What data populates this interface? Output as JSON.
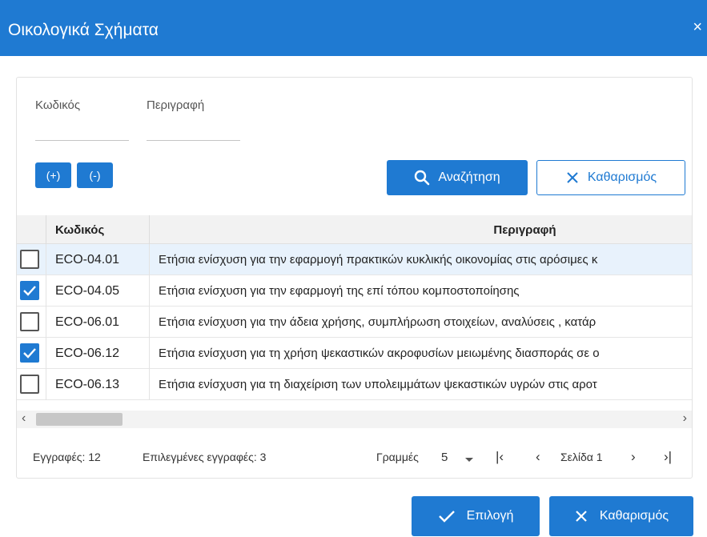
{
  "dialog": {
    "title": "Οικολογικά Σχήματα",
    "close_glyph": "×"
  },
  "filters": {
    "code_label": "Κωδικός",
    "description_label": "Περιγραφή"
  },
  "toolbar": {
    "expand_label": "(+)",
    "collapse_label": "(-)",
    "search_label": "Αναζήτηση",
    "clear_label": "Καθαρισμός"
  },
  "table": {
    "columns": [
      "Κωδικός",
      "Περιγραφή"
    ],
    "rows": [
      {
        "code": "ECO-04.01",
        "description": "Ετήσια ενίσχυση για την εφαρμογή πρακτικών κυκλικής οικονομίας στις αρόσιμες κ",
        "checked": false,
        "highlighted": true
      },
      {
        "code": "ECO-04.05",
        "description": "Ετήσια ενίσχυση για την εφαρμογή της επί τόπου κομποστοποίησης",
        "checked": true,
        "highlighted": false
      },
      {
        "code": "ECO-06.01",
        "description": "Ετήσια ενίσχυση για την άδεια χρήσης, συμπλήρωση στοιχείων, αναλύσεις , κατάρ",
        "checked": false,
        "highlighted": false
      },
      {
        "code": "ECO-06.12",
        "description": "Ετήσια ενίσχυση για τη χρήση ψεκαστικών ακροφυσίων μειωμένης διασποράς σε ο",
        "checked": true,
        "highlighted": false
      },
      {
        "code": "ECO-06.13",
        "description": "Ετήσια ενίσχυση για τη διαχείριση των υπολειμμάτων ψεκαστικών υγρών στις αροτ",
        "checked": false,
        "highlighted": false
      }
    ]
  },
  "footer": {
    "records": "Εγγραφές: 12",
    "selected": "Επιλεγμένες εγγραφές: 3",
    "rows_label": "Γραμμές",
    "rows_value": "5",
    "page_label": "Σελίδα 1"
  },
  "actions": {
    "select_label": "Επιλογή",
    "clear_label": "Καθαρισμός"
  },
  "colors": {
    "accent": "#1f7ad2",
    "row_highlight": "#e8f2fc"
  },
  "icons": [
    "close-icon",
    "search-icon",
    "clear-x-icon",
    "checkmark-icon",
    "chevron-down-icon",
    "first-page-icon",
    "prev-page-icon",
    "next-page-icon",
    "last-page-icon",
    "scroll-left-icon",
    "scroll-right-icon"
  ]
}
